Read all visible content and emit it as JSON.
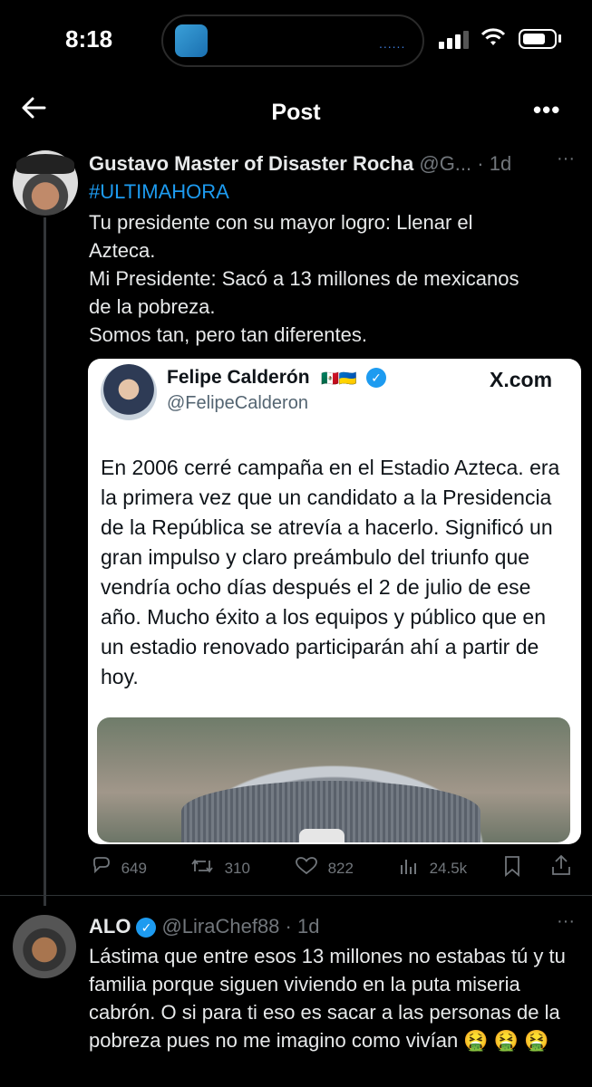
{
  "status_bar": {
    "time": "8:18",
    "island_dots": "......",
    "signal_bars": 3,
    "battery_level": 0.7
  },
  "header": {
    "title": "Post",
    "back_icon": "arrow-left",
    "more_icon": "ellipsis-horizontal",
    "more_label": "•••"
  },
  "main_post": {
    "display_name": "Gustavo Master of Disaster Rocha",
    "handle": "@G...",
    "age": "· 1d",
    "more_label": "···",
    "hashtag": "#ULTIMAHORA",
    "text": "Tu presidente con su mayor logro: Llenar el\nAzteca.\nMi Presidente: Sacó a 13 millones de mexicanos\nde la pobreza.\nSomos tan, pero tan diferentes.",
    "embedded_image": {
      "author_name": "Felipe Calderón",
      "flags": "🇲🇽🇺🇦",
      "author_handle": "@FelipeCalderon",
      "source": "X.com",
      "text": "En 2006 cerré campaña en el Estadio Azteca. era la primera vez que un candidato a la Presidencia de la República se atrevía a hacerlo. Significó un gran impulso y claro preámbulo del triunfo que vendría ocho días después el 2 de julio de ese año. Mucho éxito a los equipos y público que en un estadio renovado participarán ahí a partir de hoy."
    },
    "actions": {
      "replies": "649",
      "reposts": "310",
      "likes": "822",
      "views": "24.5k"
    }
  },
  "reply_post": {
    "display_name": "ALO",
    "handle": "@LiraChef88",
    "age": "· 1d",
    "more_label": "···",
    "text": "Lástima que entre esos 13 millones no estabas tú y tu familia porque siguen viviendo en la puta miseria cabrón. O si para ti eso es sacar a las personas de la pobreza pues no me imagino como vivían 🤮 🤮 🤮"
  },
  "colors": {
    "background": "#000000",
    "link": "#1d9bf0",
    "muted": "#71767b",
    "text": "#e7e9ea"
  }
}
